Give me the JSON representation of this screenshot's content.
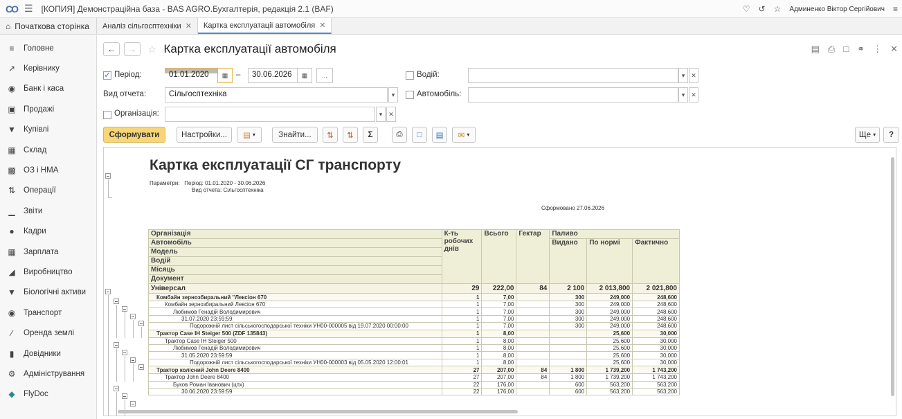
{
  "titlebar": {
    "app_title": "[КОПИЯ] Демонстраційна база - BAS AGRO.Бухгалтерія, редакція 2.1  (BAF)",
    "user": "Админенко Віктор Сергійович"
  },
  "tabs": {
    "home": "Початкова сторінка",
    "items": [
      {
        "label": "Аналіз сільгосптехніки"
      },
      {
        "label": "Картка експлуатації автомобіля"
      }
    ]
  },
  "sidebar": {
    "items": [
      {
        "label": "Головне",
        "icon": "menu-icon"
      },
      {
        "label": "Керівнику",
        "icon": "trend-icon"
      },
      {
        "label": "Банк і каса",
        "icon": "bank-icon"
      },
      {
        "label": "Продажі",
        "icon": "bag-icon"
      },
      {
        "label": "Купівлі",
        "icon": "cart-icon"
      },
      {
        "label": "Склад",
        "icon": "warehouse-icon"
      },
      {
        "label": "ОЗ і НМА",
        "icon": "truck-icon"
      },
      {
        "label": "Операції",
        "icon": "operations-icon"
      },
      {
        "label": "Звіти",
        "icon": "chart-icon"
      },
      {
        "label": "Кадри",
        "icon": "person-icon"
      },
      {
        "label": "Зарплата",
        "icon": "calculator-icon"
      },
      {
        "label": "Виробництво",
        "icon": "factory-icon"
      },
      {
        "label": "Біологічні активи",
        "icon": "cow-icon"
      },
      {
        "label": "Транспорт",
        "icon": "tractor-icon"
      },
      {
        "label": "Оренда землі",
        "icon": "leaf-icon"
      },
      {
        "label": "Довідники",
        "icon": "book-icon"
      },
      {
        "label": "Адміністрування",
        "icon": "gear-icon"
      },
      {
        "label": "FlyDoc",
        "icon": "flydoc-icon"
      }
    ]
  },
  "form": {
    "title": "Картка експлуатації автомобіля",
    "period_label": "Період:",
    "date_from": "01.01.2020",
    "date_sep": "–",
    "date_to": "30.06.2026",
    "more": "...",
    "report_type_label": "Вид отчета:",
    "report_type_value": "Сільгосптехніка",
    "organization_label": "Організація:",
    "driver_label": "Водій:",
    "vehicle_label": "Автомобіль:",
    "generate": "Сформувати",
    "settings": "Настройки...",
    "find": "Знайти...",
    "more_menu": "Ще",
    "help": "?"
  },
  "report": {
    "title": "Картка експлуатації СГ транспорту",
    "params_label": "Параметри:",
    "param1": "Період: 01.01.2020 - 30.06.2026",
    "param2": "Вид отчета: Сільгосптехніка",
    "generated": "Сформовано 27.06.2026",
    "headers": {
      "h_org": "Організація",
      "h_auto": "Автомобіль",
      "h_model": "Модель",
      "h_driver": "Водій",
      "h_month": "Місяць",
      "h_doc": "Документ",
      "h_days": "К-ть робочих днів",
      "h_total": "Всього",
      "h_ha": "Гектар",
      "h_fuel": "Паливо",
      "h_issued": "Видано",
      "h_norm": "По нормі",
      "h_actual": "Фактично"
    },
    "rows": [
      {
        "cls": "grp1",
        "indent": 0,
        "name": "Універсал",
        "days": "29",
        "total": "222,00",
        "ha": "84",
        "issued": "2 100",
        "norm": "2 013,800",
        "actual": "2 021,800"
      },
      {
        "cls": "grp2",
        "indent": 8,
        "name": "Комбайн зернозбиральний \"Лексіон 670",
        "days": "1",
        "total": "7,00",
        "ha": "",
        "issued": "300",
        "norm": "249,000",
        "actual": "248,600"
      },
      {
        "cls": "rw",
        "indent": 20,
        "name": "Комбайн зернозбиральний Лексіон 670",
        "days": "1",
        "total": "7,00",
        "ha": "",
        "issued": "300",
        "norm": "249,000",
        "actual": "248,600"
      },
      {
        "cls": "rw",
        "indent": 32,
        "name": "Любимов Генадій Володимирович",
        "days": "1",
        "total": "7,00",
        "ha": "",
        "issued": "300",
        "norm": "249,000",
        "actual": "248,600"
      },
      {
        "cls": "rw",
        "indent": 44,
        "name": "31.07.2020 23:59:59",
        "days": "1",
        "total": "7,00",
        "ha": "",
        "issued": "300",
        "norm": "249,000",
        "actual": "248,600"
      },
      {
        "cls": "rw",
        "indent": 56,
        "name": "Подорожній лист сільськогосподарської техніки УН00-000005 від 19.07.2020 00:00:00",
        "days": "1",
        "total": "7,00",
        "ha": "",
        "issued": "300",
        "norm": "249,000",
        "actual": "248,600"
      },
      {
        "cls": "grp2",
        "indent": 8,
        "name": "Трактор Case IH Steiger 500 (ZDF 135843)",
        "days": "1",
        "total": "8,00",
        "ha": "",
        "issued": "",
        "norm": "25,600",
        "actual": "30,000"
      },
      {
        "cls": "rw",
        "indent": 20,
        "name": "Трактор Case IH Steiger 500",
        "days": "1",
        "total": "8,00",
        "ha": "",
        "issued": "",
        "norm": "25,600",
        "actual": "30,000"
      },
      {
        "cls": "rw",
        "indent": 32,
        "name": "Любимов Генадій Володимирович",
        "days": "1",
        "total": "8,00",
        "ha": "",
        "issued": "",
        "norm": "25,600",
        "actual": "30,000"
      },
      {
        "cls": "rw",
        "indent": 44,
        "name": "31.05.2020 23:59:59",
        "days": "1",
        "total": "8,00",
        "ha": "",
        "issued": "",
        "norm": "25,600",
        "actual": "30,000"
      },
      {
        "cls": "rw",
        "indent": 56,
        "name": "Подорожній лист сільськогосподарської техніки УН00-000003 від 05.05.2020 12:00:01",
        "days": "1",
        "total": "8,00",
        "ha": "",
        "issued": "",
        "norm": "25,600",
        "actual": "30,000"
      },
      {
        "cls": "grp2",
        "indent": 8,
        "name": "Трактор колісний John Deere 8400",
        "days": "27",
        "total": "207,00",
        "ha": "84",
        "issued": "1 800",
        "norm": "1 739,200",
        "actual": "1 743,200"
      },
      {
        "cls": "rw",
        "indent": 20,
        "name": "Трактор John Deere 8400",
        "days": "27",
        "total": "207,00",
        "ha": "84",
        "issued": "1 800",
        "norm": "1 739,200",
        "actual": "1 743,200"
      },
      {
        "cls": "rw",
        "indent": 32,
        "name": "Буков Роман Іванович (цпх)",
        "days": "22",
        "total": "176,00",
        "ha": "",
        "issued": "600",
        "norm": "563,200",
        "actual": "563,200"
      },
      {
        "cls": "rw",
        "indent": 44,
        "name": "30.06.2020 23:59:59",
        "days": "22",
        "total": "176,00",
        "ha": "",
        "issued": "600",
        "norm": "563,200",
        "actual": "563,200"
      }
    ]
  }
}
